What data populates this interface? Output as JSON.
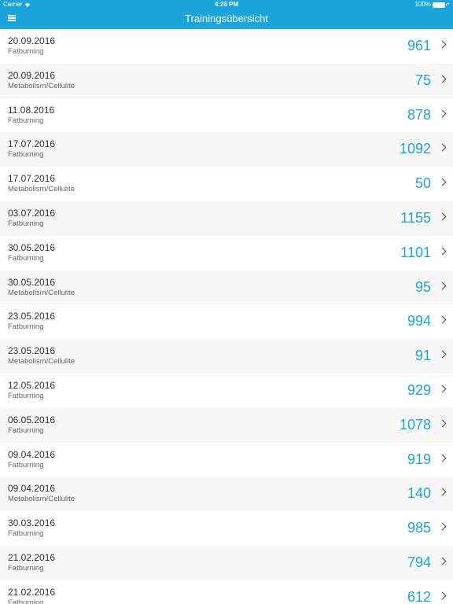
{
  "status": {
    "carrier": "Carrier",
    "time": "4:26 PM",
    "battery": "100%"
  },
  "nav": {
    "title": "Trainingsübersicht"
  },
  "colors": {
    "accent": "#1aa6dc"
  },
  "trainings": [
    {
      "date": "20.09.2016",
      "category": "Fatburning",
      "value": "961"
    },
    {
      "date": "20.09.2016",
      "category": "Metabolism/Cellulite",
      "value": "75"
    },
    {
      "date": "11.08.2016",
      "category": "Fatburning",
      "value": "878"
    },
    {
      "date": "17.07.2016",
      "category": "Fatburning",
      "value": "1092"
    },
    {
      "date": "17.07.2016",
      "category": "Metabolism/Cellulite",
      "value": "50"
    },
    {
      "date": "03.07.2016",
      "category": "Fatburning",
      "value": "1155"
    },
    {
      "date": "30.05.2016",
      "category": "Fatburning",
      "value": "1101"
    },
    {
      "date": "30.05.2016",
      "category": "Metabolism/Cellulite",
      "value": "95"
    },
    {
      "date": "23.05.2016",
      "category": "Fatburning",
      "value": "994"
    },
    {
      "date": "23.05.2016",
      "category": "Metabolism/Cellulite",
      "value": "91"
    },
    {
      "date": "12.05.2016",
      "category": "Fatburning",
      "value": "929"
    },
    {
      "date": "06.05.2016",
      "category": "Fatburning",
      "value": "1078"
    },
    {
      "date": "09.04.2016",
      "category": "Fatburning",
      "value": "919"
    },
    {
      "date": "09.04.2016",
      "category": "Metabolism/Cellulite",
      "value": "140"
    },
    {
      "date": "30.03.2016",
      "category": "Fatburning",
      "value": "985"
    },
    {
      "date": "21.02.2016",
      "category": "Fatburning",
      "value": "794"
    },
    {
      "date": "21.02.2016",
      "category": "Fatburning",
      "value": "612"
    }
  ]
}
